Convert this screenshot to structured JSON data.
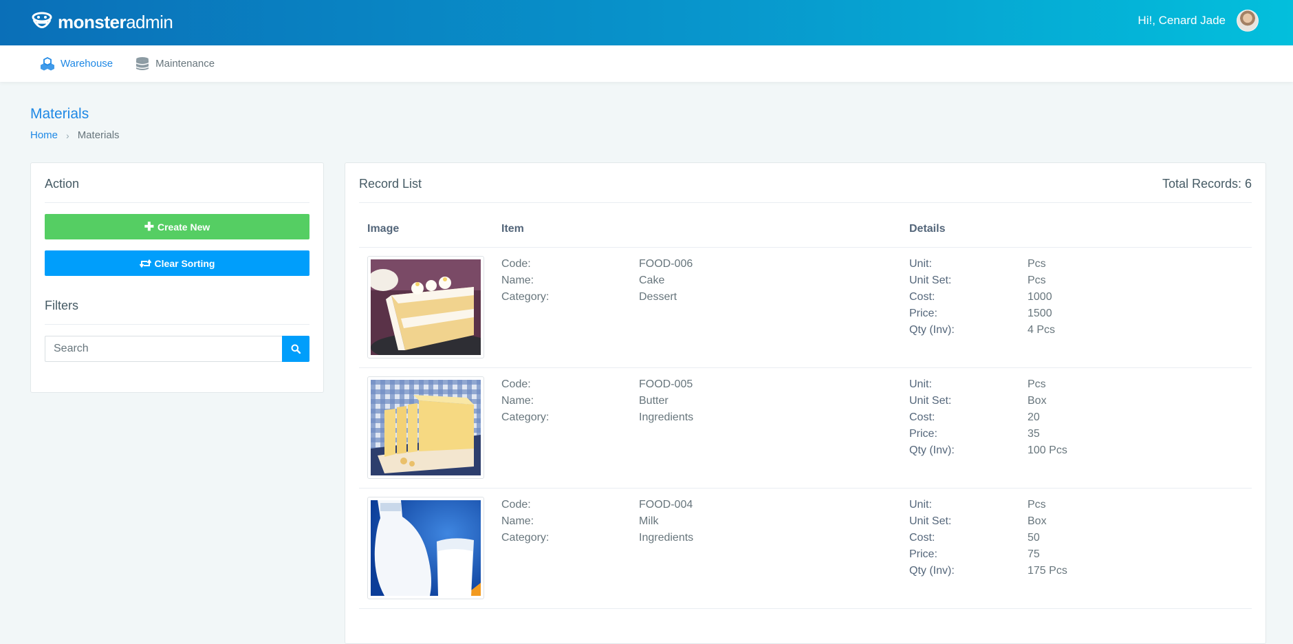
{
  "brand": {
    "bold": "monster",
    "light": "admin"
  },
  "user": {
    "greeting": "Hi!, Cenard Jade"
  },
  "nav": [
    {
      "label": "Warehouse",
      "icon": "cubes-icon",
      "active": true
    },
    {
      "label": "Maintenance",
      "icon": "database-icon",
      "active": false
    }
  ],
  "page": {
    "title": "Materials"
  },
  "breadcrumb": {
    "home": "Home",
    "current": "Materials"
  },
  "action": {
    "title": "Action",
    "create_label": "Create New",
    "clear_label": "Clear Sorting",
    "filters_title": "Filters",
    "search_placeholder": "Search"
  },
  "list": {
    "title": "Record List",
    "total": "Total Records: 6",
    "headers": {
      "image": "Image",
      "item": "Item",
      "details": "Details"
    },
    "labels": {
      "code": "Code:",
      "name": "Name:",
      "category": "Category:",
      "unit": "Unit:",
      "unit_set": "Unit Set:",
      "cost": "Cost:",
      "price": "Price:",
      "qty": "Qty (Inv):"
    },
    "rows": [
      {
        "code": "FOOD-006",
        "name": "Cake",
        "category": "Dessert",
        "unit": "Pcs",
        "unit_set": "Pcs",
        "cost": "1000",
        "price": "1500",
        "qty": "4 Pcs",
        "image": "cake"
      },
      {
        "code": "FOOD-005",
        "name": "Butter",
        "category": "Ingredients",
        "unit": "Pcs",
        "unit_set": "Box",
        "cost": "20",
        "price": "35",
        "qty": "100 Pcs",
        "image": "butter"
      },
      {
        "code": "FOOD-004",
        "name": "Milk",
        "category": "Ingredients",
        "unit": "Pcs",
        "unit_set": "Box",
        "cost": "50",
        "price": "75",
        "qty": "175 Pcs",
        "image": "milk"
      }
    ]
  },
  "colors": {
    "primary": "#1e88e5",
    "success": "#55ce63",
    "info": "#009efb",
    "text": "#67757c"
  }
}
